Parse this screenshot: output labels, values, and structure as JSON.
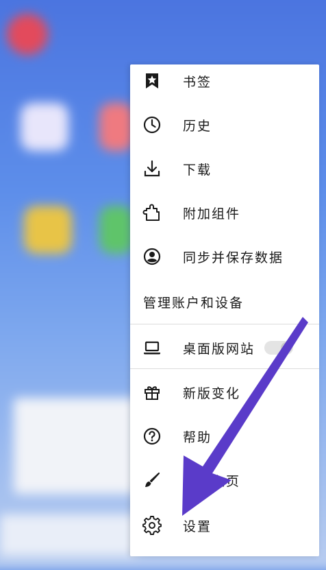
{
  "menu": {
    "items": [
      {
        "label": "书签",
        "icon": "star-icon"
      },
      {
        "label": "历史",
        "icon": "clock-icon"
      },
      {
        "label": "下载",
        "icon": "download-icon"
      },
      {
        "label": "附加组件",
        "icon": "puzzle-icon"
      },
      {
        "label": "同步并保存数据",
        "icon": "account-icon"
      }
    ],
    "manage_label": "管理账户和设备",
    "desktop_site": {
      "label": "桌面版网站",
      "icon": "laptop-icon",
      "enabled": false
    },
    "items2": [
      {
        "label": "新版变化",
        "icon": "gift-icon"
      },
      {
        "label": "帮助",
        "icon": "help-icon"
      },
      {
        "label": "定制主页",
        "icon": "brush-icon"
      },
      {
        "label": "设置",
        "icon": "gear-icon"
      }
    ]
  },
  "colors": {
    "arrow": "#5a3bc9",
    "background": "#5b8de8"
  }
}
